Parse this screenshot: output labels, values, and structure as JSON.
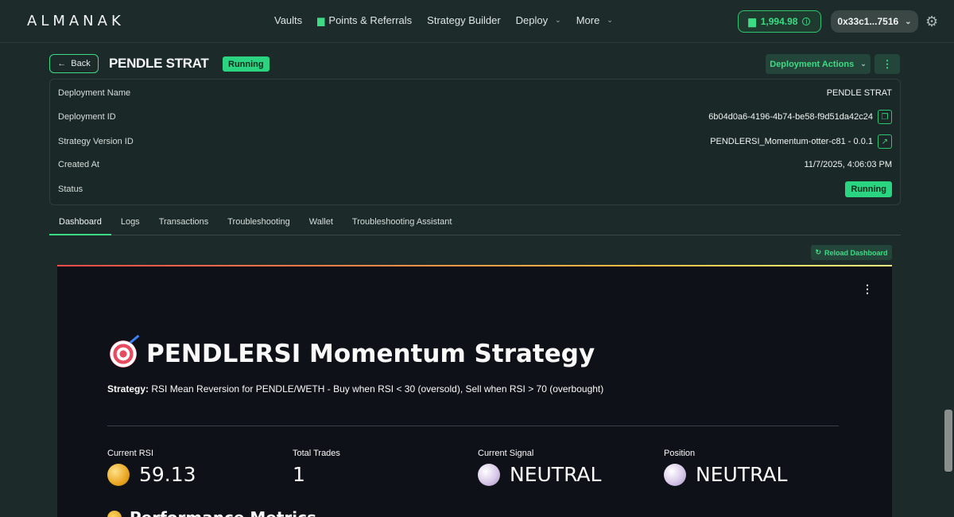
{
  "header": {
    "logo": "ALMANAK",
    "nav": [
      {
        "label": "Vaults"
      },
      {
        "label": "Points & Referrals"
      },
      {
        "label": "Strategy Builder"
      },
      {
        "label": "Deploy"
      },
      {
        "label": "More"
      }
    ],
    "points": "1,994.98",
    "wallet": "0x33c1...7516"
  },
  "title_row": {
    "back_label": "Back",
    "title": "PENDLE STRAT",
    "status": "Running",
    "deployment_actions": "Deployment Actions"
  },
  "details": {
    "rows": [
      {
        "key": "Deployment Name",
        "value": "PENDLE STRAT"
      },
      {
        "key": "Deployment ID",
        "value": "6b04d0a6-4196-4b74-be58-f9d51da42c24"
      },
      {
        "key": "Strategy Version ID",
        "value": "PENDLERSI_Momentum-otter-c81 - 0.0.1"
      },
      {
        "key": "Created At",
        "value": "11/7/2025, 4:06:03 PM"
      },
      {
        "key": "Status",
        "value": "Running"
      }
    ]
  },
  "tabs": [
    {
      "label": "Dashboard",
      "active": true
    },
    {
      "label": "Logs"
    },
    {
      "label": "Transactions"
    },
    {
      "label": "Troubleshooting"
    },
    {
      "label": "Wallet"
    },
    {
      "label": "Troubleshooting Assistant"
    }
  ],
  "reload_label": "Reload Dashboard",
  "dashboard": {
    "title": "PENDLERSI Momentum Strategy",
    "strategy_label": "Strategy:",
    "strategy_text": " RSI Mean Reversion for PENDLE/WETH - Buy when RSI < 30 (oversold), Sell when RSI > 70 (overbought)",
    "metrics": [
      {
        "label": "Current RSI",
        "value": "59.13",
        "icon": "gold-orb"
      },
      {
        "label": "Total Trades",
        "value": "1",
        "icon": ""
      },
      {
        "label": "Current Signal",
        "value": "NEUTRAL",
        "icon": "pearl-orb"
      },
      {
        "label": "Position",
        "value": "NEUTRAL",
        "icon": "pearl-orb"
      }
    ],
    "performance_heading": "Performance Metrics"
  },
  "colors": {
    "accent": "#3ddc84",
    "background": "#1c2a2a",
    "dashboard_bg": "#0e1117"
  }
}
